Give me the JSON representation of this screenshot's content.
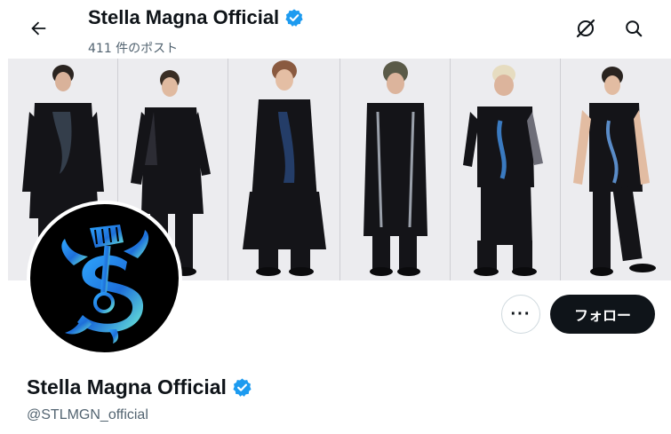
{
  "header": {
    "title": "Stella Magna Official",
    "post_count": "411 件のポスト"
  },
  "profile": {
    "display_name": "Stella Magna Official",
    "handle": "@STLMGN_official",
    "verified": true,
    "follow_label": "フォロー",
    "more_label": "···"
  },
  "banner": {
    "member_count": 6
  },
  "colors": {
    "verified_badge": "#1d9bf0",
    "follow_button_bg": "#0f1419",
    "secondary_text": "#536471"
  },
  "icons": {
    "back": "arrow-left-icon",
    "grok": "grok-icon",
    "search": "search-icon",
    "verified": "verified-badge-icon"
  }
}
